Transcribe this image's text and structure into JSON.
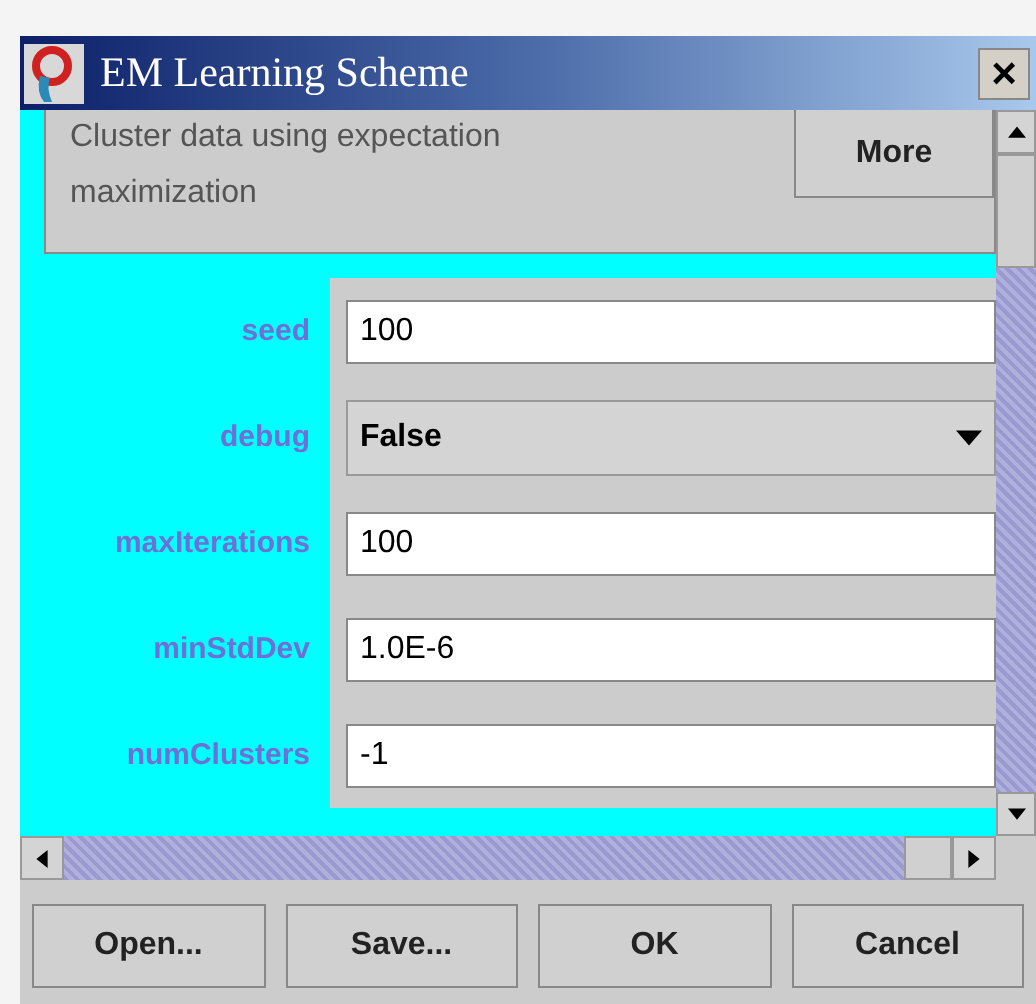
{
  "window": {
    "title": "EM Learning Scheme",
    "close": "×"
  },
  "about": {
    "text": "Cluster data using expectation maximization",
    "button": "More"
  },
  "fields": [
    {
      "label": "seed",
      "kind": "text",
      "value": "100"
    },
    {
      "label": "debug",
      "kind": "dropdown",
      "value": "False"
    },
    {
      "label": "maxIterations",
      "kind": "text",
      "value": "100"
    },
    {
      "label": "minStdDev",
      "kind": "text",
      "value": "1.0E-6"
    },
    {
      "label": "numClusters",
      "kind": "text",
      "value": "-1"
    }
  ],
  "buttons": [
    "Open...",
    "Save...",
    "OK",
    "Cancel"
  ]
}
